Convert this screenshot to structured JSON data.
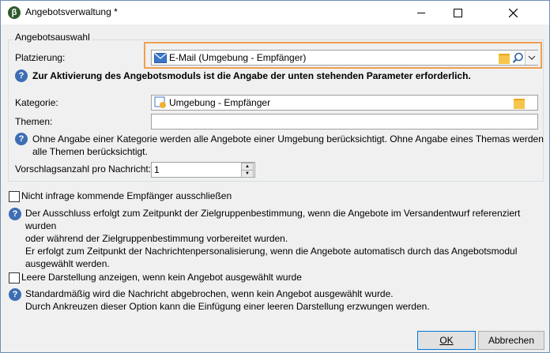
{
  "window": {
    "title": "Angebotsverwaltung *",
    "app_icon_glyph": "β"
  },
  "group": {
    "legend": "Angebotsauswahl"
  },
  "placement": {
    "label": "Platzierung:",
    "value": "E-Mail (Umgebung - Empfänger)",
    "icon": "mail-icon"
  },
  "info_required": "Zur Aktivierung des Angebotsmoduls ist die Angabe der unten stehenden Parameter erforderlich.",
  "category": {
    "label": "Kategorie:",
    "value": "Umgebung - Empfänger",
    "icon": "category-icon"
  },
  "themes": {
    "label": "Themen:",
    "value": ""
  },
  "info_category": [
    "Ohne Angabe einer Kategorie werden alle Angebote einer Umgebung berücksichtigt. Ohne Angabe eines Themas werden",
    "alle Themen berücksichtigt."
  ],
  "count": {
    "label": "Vorschlagsanzahl pro Nachricht:",
    "value": "1"
  },
  "exclude": {
    "label": "Nicht infrage kommende Empfänger ausschließen",
    "checked": false,
    "info": [
      "Der Ausschluss erfolgt zum Zeitpunkt der Zielgruppenbestimmung, wenn die Angebote im Versandentwurf referenziert wurden",
      "oder während der Zielgruppenbestimmung vorbereitet wurden.",
      "Er erfolgt zum Zeitpunkt der Nachrichtenpersonalisierung, wenn die Angebote automatisch durch das Angebotsmodul",
      "ausgewählt werden."
    ]
  },
  "empty_display": {
    "label": "Leere Darstellung anzeigen, wenn kein Angebot ausgewählt wurde",
    "checked": false,
    "info": [
      "Standardmäßig wird die Nachricht abgebrochen, wenn kein Angebot ausgewählt wurde.",
      "Durch Ankreuzen dieser Option kann die Einfügung einer leeren Darstellung erzwungen werden."
    ]
  },
  "buttons": {
    "ok": "OK",
    "cancel": "Abbrechen"
  },
  "colors": {
    "highlight": "#f0a050",
    "info_icon": "#3d6eb4",
    "folder": "#f6c54a"
  }
}
